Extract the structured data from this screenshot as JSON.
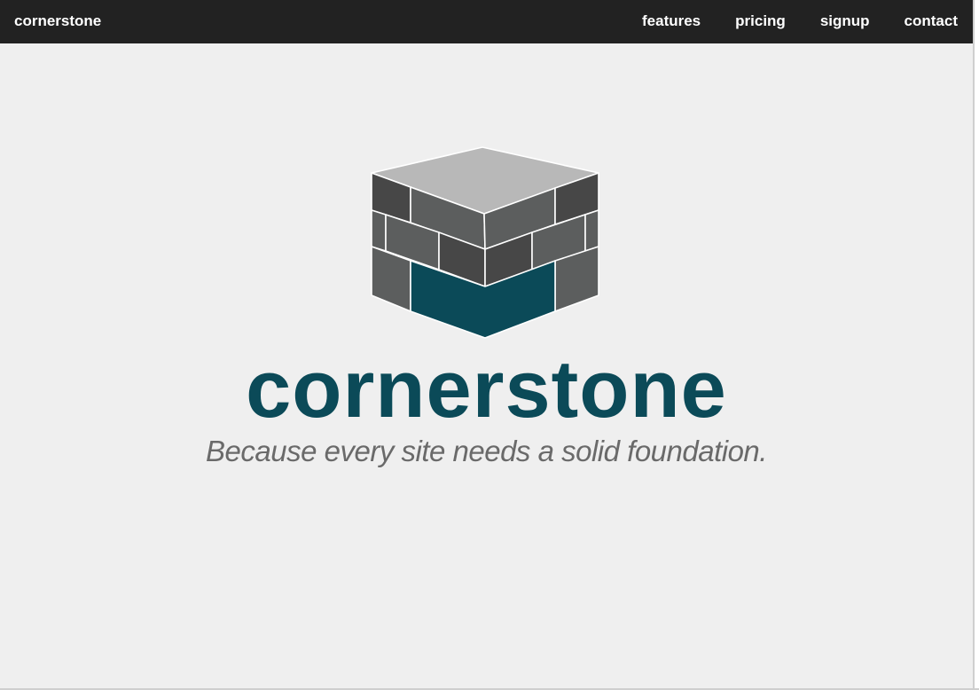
{
  "navbar": {
    "brand": "cornerstone",
    "links": [
      {
        "label": "features"
      },
      {
        "label": "pricing"
      },
      {
        "label": "signup"
      },
      {
        "label": "contact"
      }
    ]
  },
  "hero": {
    "logo_icon": "brick-cube-logo",
    "title": "cornerstone",
    "tagline": "Because every site needs a solid foundation."
  },
  "colors": {
    "navbar_bg": "#222222",
    "page_bg": "#efefef",
    "brand_teal": "#0b4a58",
    "tagline_gray": "#6a6a6a",
    "brick_dark": "#474747",
    "brick_mid": "#5c5e5e",
    "cube_top": "#b8b8b8"
  }
}
